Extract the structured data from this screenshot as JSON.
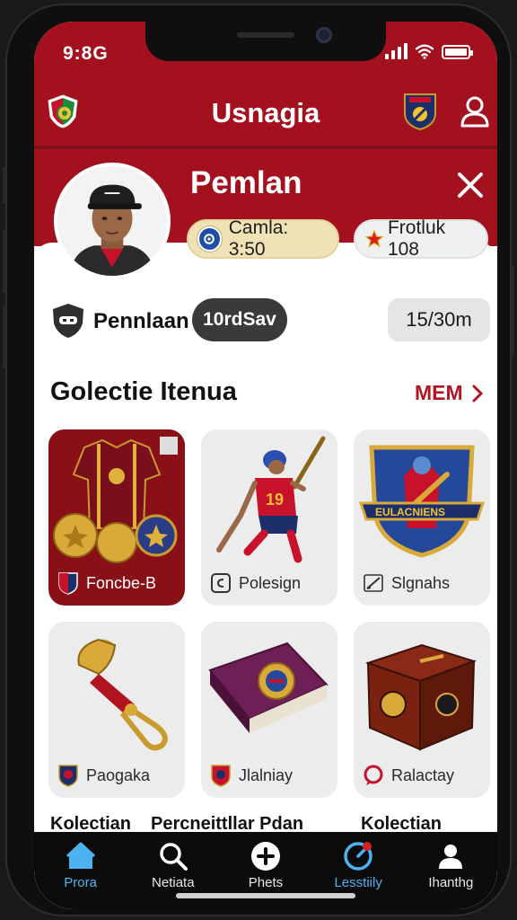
{
  "status": {
    "time": "9:8G"
  },
  "header": {
    "title": "Usnagia"
  },
  "profile": {
    "name": "Pemlan",
    "chips": [
      {
        "label": "Camla: 3:50",
        "icon": "coin-icon"
      },
      {
        "label": "Frotluk 108",
        "icon": "star-icon"
      }
    ]
  },
  "stats": {
    "label": "Pennlaan",
    "pill": "10rdSav",
    "time": "15/30m"
  },
  "collection": {
    "title": "Golectie Itenua",
    "more_label": "MEM",
    "cards": [
      {
        "label": "Foncbe-B"
      },
      {
        "label": "Polesign"
      },
      {
        "label": "Slgnahs"
      },
      {
        "label": "Paogaka"
      },
      {
        "label": "Jlalniay"
      },
      {
        "label": "Ralactay"
      }
    ],
    "captions": [
      "Kolectian",
      "Percneittllar Pdan",
      "Kolectian"
    ]
  },
  "nav": [
    {
      "label": "Prora",
      "icon": "home-icon",
      "active": true
    },
    {
      "label": "Netiata",
      "icon": "search-icon",
      "active": false
    },
    {
      "label": "Phets",
      "icon": "plus-icon",
      "active": false
    },
    {
      "label": "Lesstiily",
      "icon": "activity-icon",
      "active": true
    },
    {
      "label": "Ihanthg",
      "icon": "person-icon",
      "active": false
    }
  ],
  "colors": {
    "brand_red": "#a3111f",
    "accent_red": "#b21523",
    "active_blue": "#4fb2f0",
    "nav_bg": "#0b0b0c"
  }
}
